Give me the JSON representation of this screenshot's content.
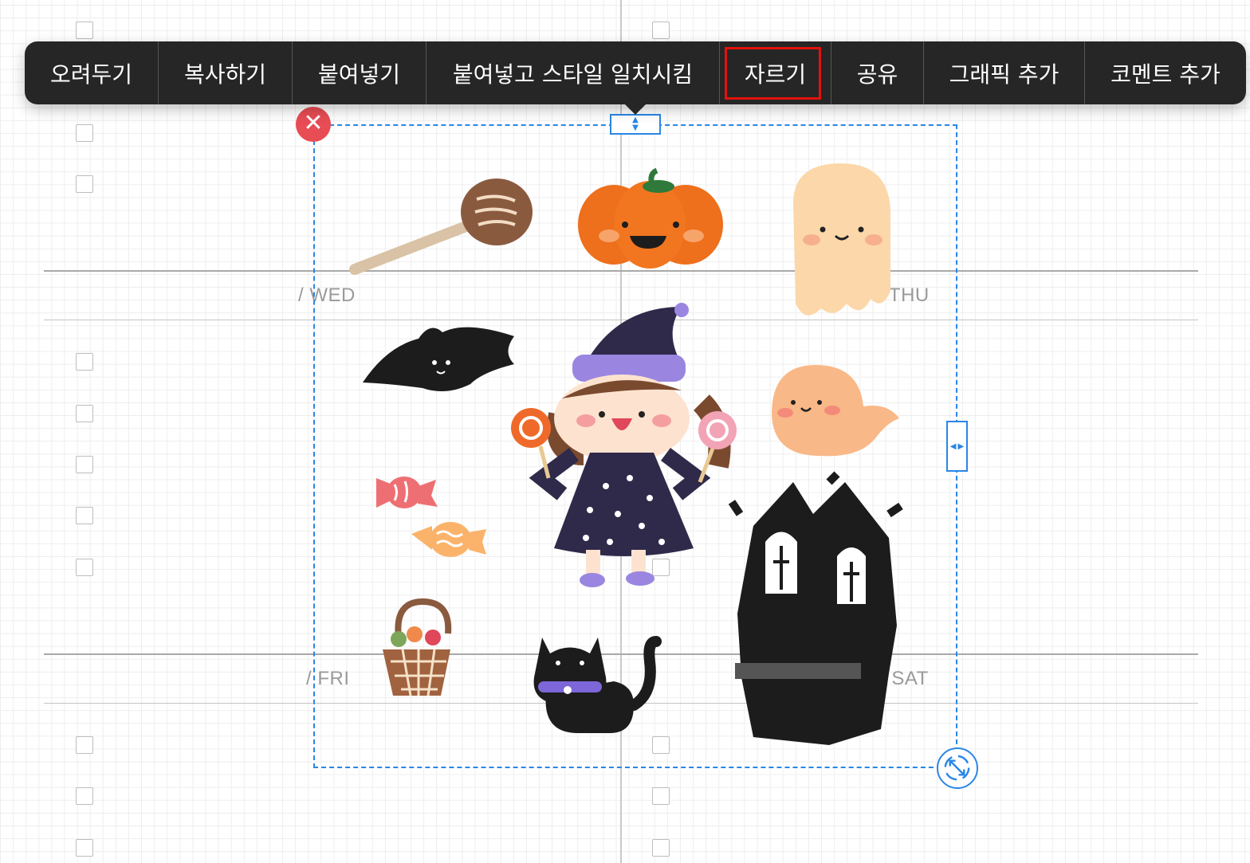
{
  "menu": {
    "items": [
      {
        "label": "오려두기"
      },
      {
        "label": "복사하기"
      },
      {
        "label": "붙여넣기"
      },
      {
        "label": "붙여넣고 스타일 일치시킴"
      },
      {
        "label": "자르기",
        "highlighted": true
      },
      {
        "label": "공유"
      },
      {
        "label": "그래픽 추가"
      },
      {
        "label": "코멘트 추가"
      }
    ]
  },
  "planner": {
    "days": {
      "wed": "/  WED",
      "thu": "/  THU",
      "fri": "/  FRI",
      "sat": "/  SAT"
    }
  },
  "selection": {
    "close_icon": "close-icon",
    "color": "#2a86e6",
    "close_color": "#e84c54"
  },
  "stickers": [
    "broom-sticker",
    "pumpkin-sticker",
    "ghost-sticker",
    "bat-sticker",
    "witch-girl-sticker",
    "small-ghost-sticker",
    "candy-sticker",
    "candy-sticker",
    "haunted-house-sticker",
    "basket-sticker",
    "black-cat-sticker"
  ],
  "highlight_color": "#e3120b"
}
